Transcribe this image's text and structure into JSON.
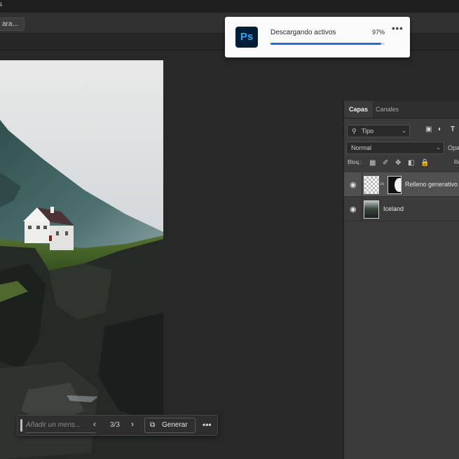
{
  "menubar": {
    "visible_text": "s"
  },
  "options_bar": {
    "button_label": "ara..."
  },
  "notification": {
    "app_icon_text": "Ps",
    "message": "Descargando activos",
    "progress_text": "97%",
    "progress": 0.97,
    "more_label": "•••"
  },
  "layers_panel": {
    "tabs": [
      {
        "label": "Capas",
        "active": true
      },
      {
        "label": "Canales",
        "active": false
      }
    ],
    "filter": {
      "label": "Tipo",
      "icon": "search-icon"
    },
    "filter_icons": [
      "image-filter-icon",
      "adjustment-filter-icon",
      "type-filter-icon"
    ],
    "blend_mode": "Normal",
    "opacity_label": "Opa",
    "lock": {
      "label": "Bloq.:",
      "fill_label": "Re"
    },
    "layers": [
      {
        "name": "Relleno generativo",
        "selected": true,
        "has_mask": true
      },
      {
        "name": "Iceland",
        "selected": false,
        "has_mask": false
      }
    ]
  },
  "generate_bar": {
    "placeholder": "Añadir un mens...",
    "counter": "3/3",
    "generate_label": "Generar",
    "more_label": "•••"
  },
  "colors": {
    "accent": "#1473e6",
    "ps_blue": "#31a8ff",
    "ps_bg": "#001e36"
  }
}
